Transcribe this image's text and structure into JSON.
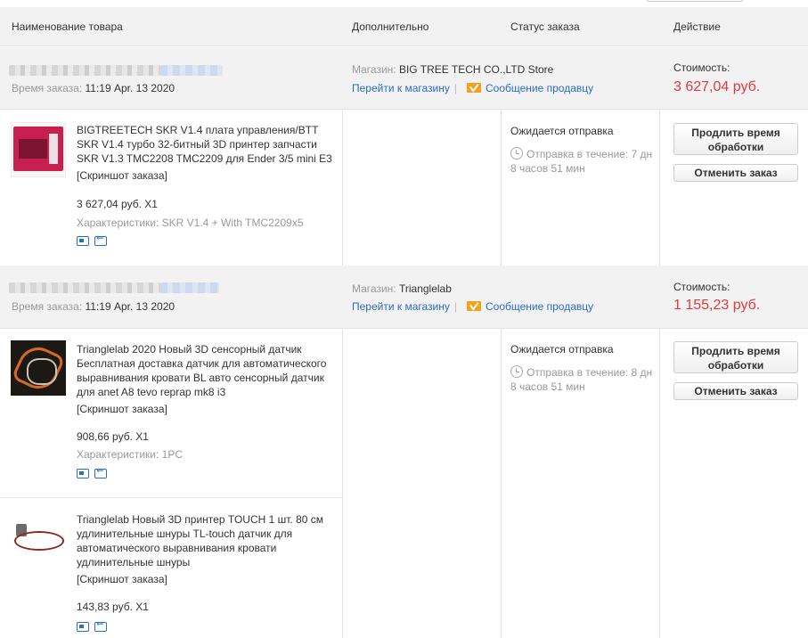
{
  "header": {
    "col_product": "Наименование товара",
    "col_extra": "Дополнительно",
    "col_status": "Статус заказа",
    "col_action": "Действие"
  },
  "labels": {
    "order_time": "Время заказа:",
    "store": "Магазин:",
    "go_to_store": "Перейти к магазину",
    "message_seller": "Сообщение продавцу",
    "cost": "Стоимость:",
    "screenshot": "[Скриншот заказа]",
    "specs": "Характеристики:",
    "awaiting_shipment": "Ожидается отправка",
    "extend_button": "Продлить время обработки",
    "cancel_button": "Отменить заказ"
  },
  "orders": [
    {
      "time": "11:19 Apr. 13 2020",
      "store": "BIG TREE TECH CO.,LTD Store",
      "total": "3 627,04 руб.",
      "ship_text": "Отправка в течение: 7 дн 8 часов 51 мин",
      "items": [
        {
          "title": "BIGTREETECH SKR V1.4 плата управления/BTT SKR V1.4 турбо 32-битный 3D принтер запчасти SKR V1.3 TMC2208 TMC2209 для Ender 3/5 mini E3",
          "price": "3 627,04 руб. X1",
          "spec_value": "SKR V1.4 + With TMC2209x5"
        }
      ]
    },
    {
      "time": "11:19 Apr. 13 2020",
      "store": "Trianglelab",
      "total": "1 155,23 руб.",
      "ship_text": "Отправка в течение: 8 дн 8 часов 51 мин",
      "items": [
        {
          "title": "Trianglelab 2020 Новый 3D сенсорный датчик Бесплатная доставка датчик для автоматического выравнивания кровати BL авто сенсорный датчик для anet A8 tevo reprap mk8 i3",
          "price": "908,66 руб. X1",
          "spec_value": "1PC"
        },
        {
          "title": "Trianglelab Новый 3D принтер TOUCH 1 шт. 80 см удлинительные шнуры TL-touch датчик для автоматического выравнивания кровати удлинительные шнуры",
          "price": "143,83 руб. X1"
        }
      ]
    }
  ]
}
